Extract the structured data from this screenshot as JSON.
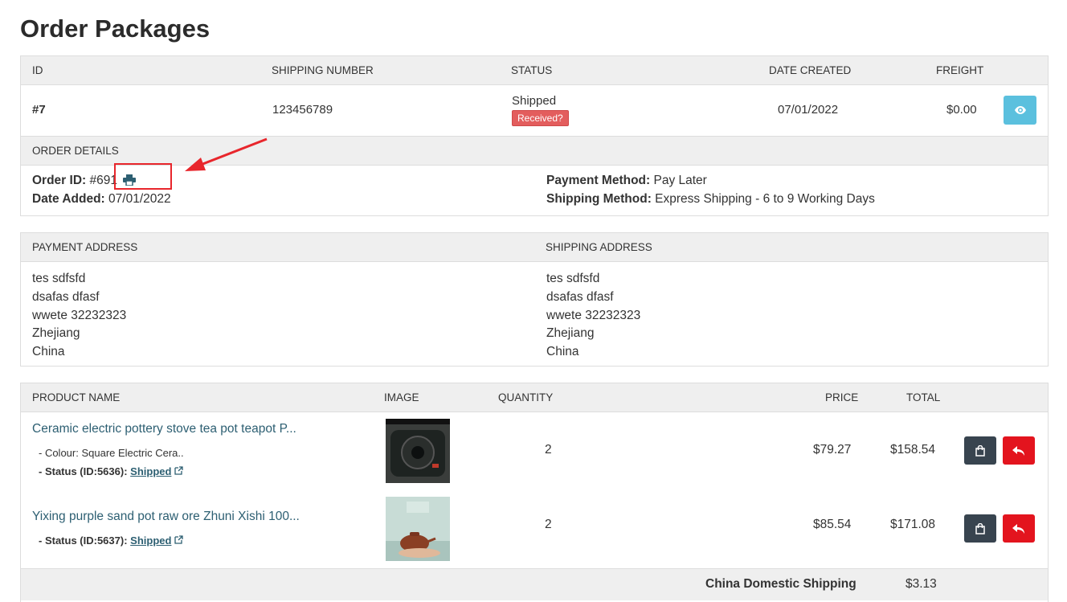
{
  "page": {
    "title": "Order Packages"
  },
  "packages": {
    "headers": {
      "id": "ID",
      "shipping_number": "SHIPPING NUMBER",
      "status": "STATUS",
      "date_created": "DATE CREATED",
      "freight": "FREIGHT"
    },
    "row": {
      "id": "#7",
      "shipping_number": "123456789",
      "status": "Shipped",
      "received_badge": "Received?",
      "date_created": "07/01/2022",
      "freight": "$0.00"
    }
  },
  "order_details": {
    "heading": "ORDER DETAILS",
    "order_id_label": "Order ID:",
    "order_id_value": "#691",
    "date_added_label": "Date Added:",
    "date_added_value": "07/01/2022",
    "payment_method_label": "Payment Method:",
    "payment_method_value": "Pay Later",
    "shipping_method_label": "Shipping Method:",
    "shipping_method_value": "Express Shipping - 6 to 9 Working Days"
  },
  "addresses": {
    "payment_heading": "PAYMENT ADDRESS",
    "shipping_heading": "SHIPPING ADDRESS",
    "payment_lines": [
      "tes sdfsfd",
      "dsafas dfasf",
      "wwete 32232323",
      "Zhejiang",
      "China"
    ],
    "shipping_lines": [
      "tes sdfsfd",
      "dsafas dfasf",
      "wwete 32232323",
      "Zhejiang",
      "China"
    ]
  },
  "products": {
    "headers": {
      "name": "PRODUCT NAME",
      "image": "IMAGE",
      "quantity": "QUANTITY",
      "price": "PRICE",
      "total": "TOTAL"
    },
    "items": [
      {
        "name": "Ceramic electric pottery stove tea pot teapot P...",
        "option": "- Colour: Square Electric Cera..",
        "status_label": "- Status (ID:5636):",
        "status_link": "Shipped",
        "quantity": "2",
        "price": "$79.27",
        "total": "$158.54"
      },
      {
        "name": "Yixing purple sand pot raw ore Zhuni Xishi 100...",
        "status_label": "- Status (ID:5637):",
        "status_link": "Shipped",
        "quantity": "2",
        "price": "$85.54",
        "total": "$171.08"
      }
    ],
    "footer": {
      "label": "China Domestic Shipping",
      "value": "$3.13"
    }
  },
  "colors": {
    "link": "#2d5f72",
    "view_button": "#5bc0de",
    "cart_button": "#38444f",
    "return_button": "#e3141e",
    "badge": "#e35d5d",
    "annotation": "#e8262c"
  },
  "icons": [
    "eye-icon",
    "print-icon",
    "external-link-icon",
    "shopping-bag-icon",
    "reply-icon",
    "arrow-annotation"
  ]
}
